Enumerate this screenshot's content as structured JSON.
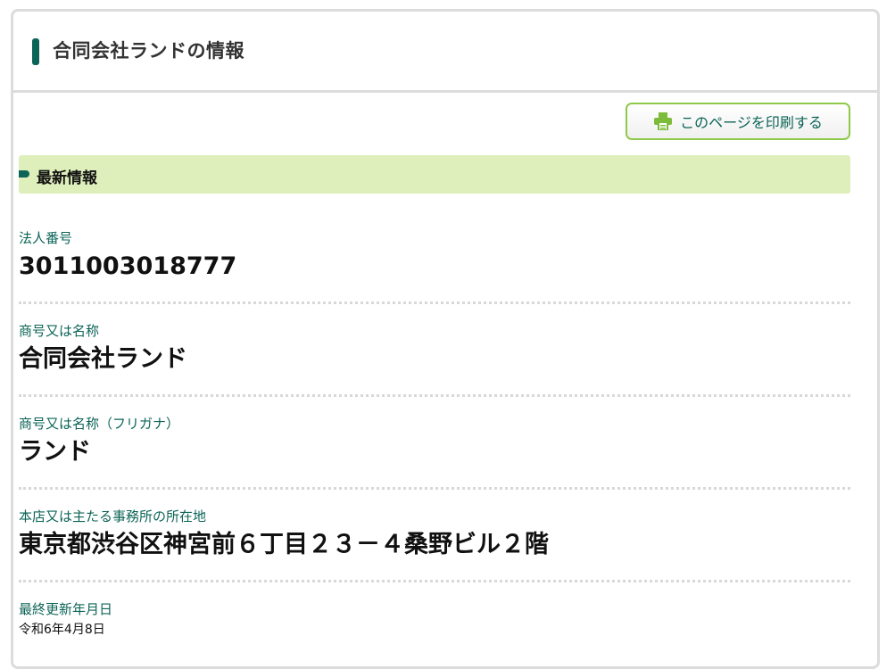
{
  "panel": {
    "title": "合同会社ランドの情報"
  },
  "toolbar": {
    "print_label": "このページを印刷する",
    "print_icon": "printer-icon",
    "accent_color": "#8fc94a"
  },
  "section": {
    "label": "最新情報"
  },
  "fields": [
    {
      "label": "法人番号",
      "value": "3011003018777"
    },
    {
      "label": "商号又は名称",
      "value": "合同会社ランド"
    },
    {
      "label": "商号又は名称（フリガナ）",
      "value": "ランド"
    },
    {
      "label": "本店又は主たる事務所の所在地",
      "value": "東京都渋谷区神宮前６丁目２３－４桑野ビル２階"
    },
    {
      "label": "最終更新年月日",
      "value": "令和6年4月8日"
    }
  ],
  "colors": {
    "brand": "#0c6457",
    "banner": "#deefbb",
    "border": "#dcdcdc"
  }
}
